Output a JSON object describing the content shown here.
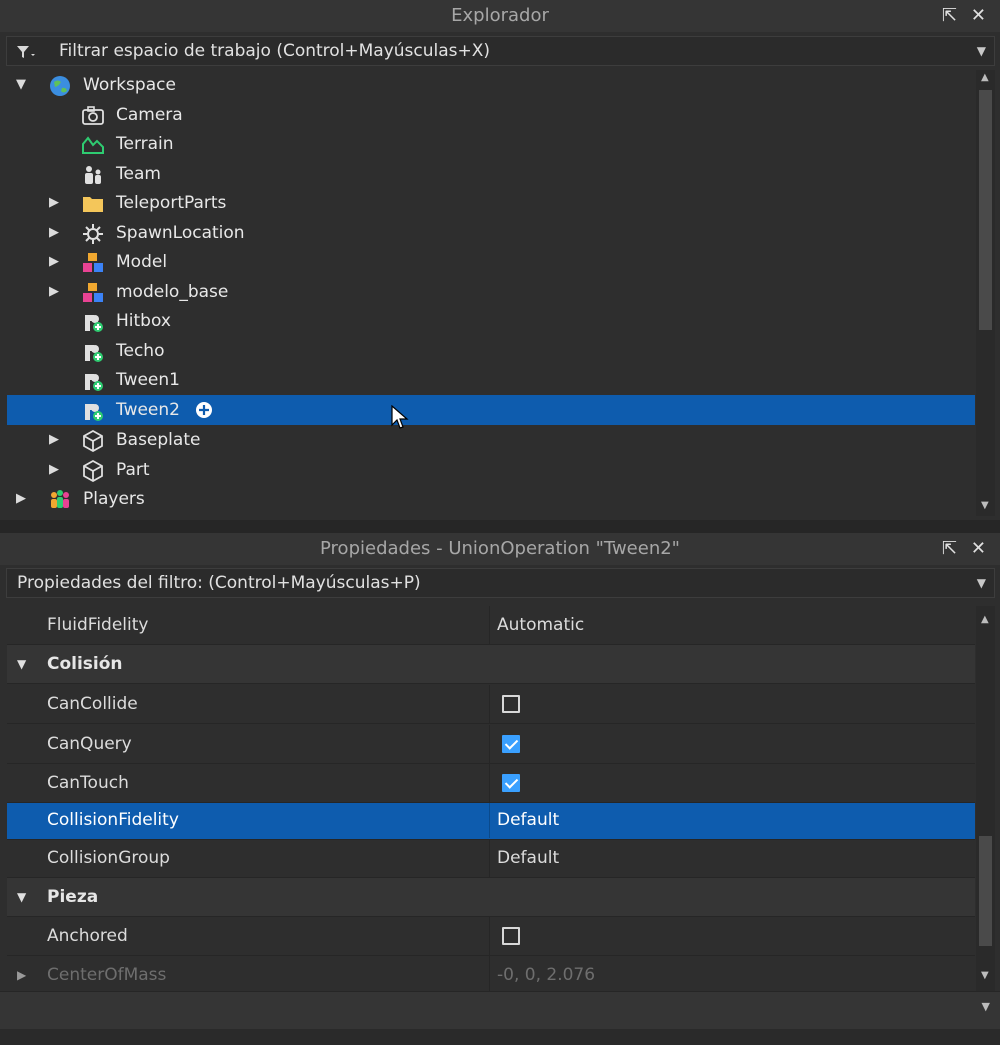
{
  "explorer": {
    "title": "Explorador",
    "filter_placeholder": "Filtrar espacio de trabajo (Control+Mayúsculas+X)",
    "items": [
      {
        "label": "Workspace",
        "icon": "globe-icon"
      },
      {
        "label": "Camera",
        "icon": "camera-icon"
      },
      {
        "label": "Terrain",
        "icon": "terrain-icon"
      },
      {
        "label": "Team",
        "icon": "team-icon"
      },
      {
        "label": "TeleportParts",
        "icon": "folder-icon"
      },
      {
        "label": "SpawnLocation",
        "icon": "spawn-icon"
      },
      {
        "label": "Model",
        "icon": "model-icon"
      },
      {
        "label": "modelo_base",
        "icon": "model-icon"
      },
      {
        "label": "Hitbox",
        "icon": "union-icon"
      },
      {
        "label": "Techo",
        "icon": "union-icon"
      },
      {
        "label": "Tween1",
        "icon": "union-icon"
      },
      {
        "label": "Tween2",
        "icon": "union-icon",
        "selected": true
      },
      {
        "label": "Baseplate",
        "icon": "part-icon"
      },
      {
        "label": "Part",
        "icon": "part-icon"
      },
      {
        "label": "Players",
        "icon": "players-icon"
      }
    ]
  },
  "properties": {
    "title": "Propiedades - UnionOperation \"Tween2\"",
    "filter_placeholder": "Propiedades del filtro: (Control+Mayúsculas+P)",
    "rows": [
      {
        "name": "FluidFidelity",
        "value": "Automatic"
      },
      {
        "name": "Colisión",
        "category": true
      },
      {
        "name": "CanCollide",
        "checked": false
      },
      {
        "name": "CanQuery",
        "checked": true
      },
      {
        "name": "CanTouch",
        "checked": true
      },
      {
        "name": "CollisionFidelity",
        "value": "Default",
        "selected": true
      },
      {
        "name": "CollisionGroup",
        "value": "Default"
      },
      {
        "name": "Pieza",
        "category": true
      },
      {
        "name": "Anchored",
        "checked": false
      },
      {
        "name": "CenterOfMass",
        "value": "-0, 0, 2.076"
      }
    ]
  },
  "colors": {
    "selection": "#0e5cae",
    "checkbox_checked": "#3aa0ff"
  }
}
